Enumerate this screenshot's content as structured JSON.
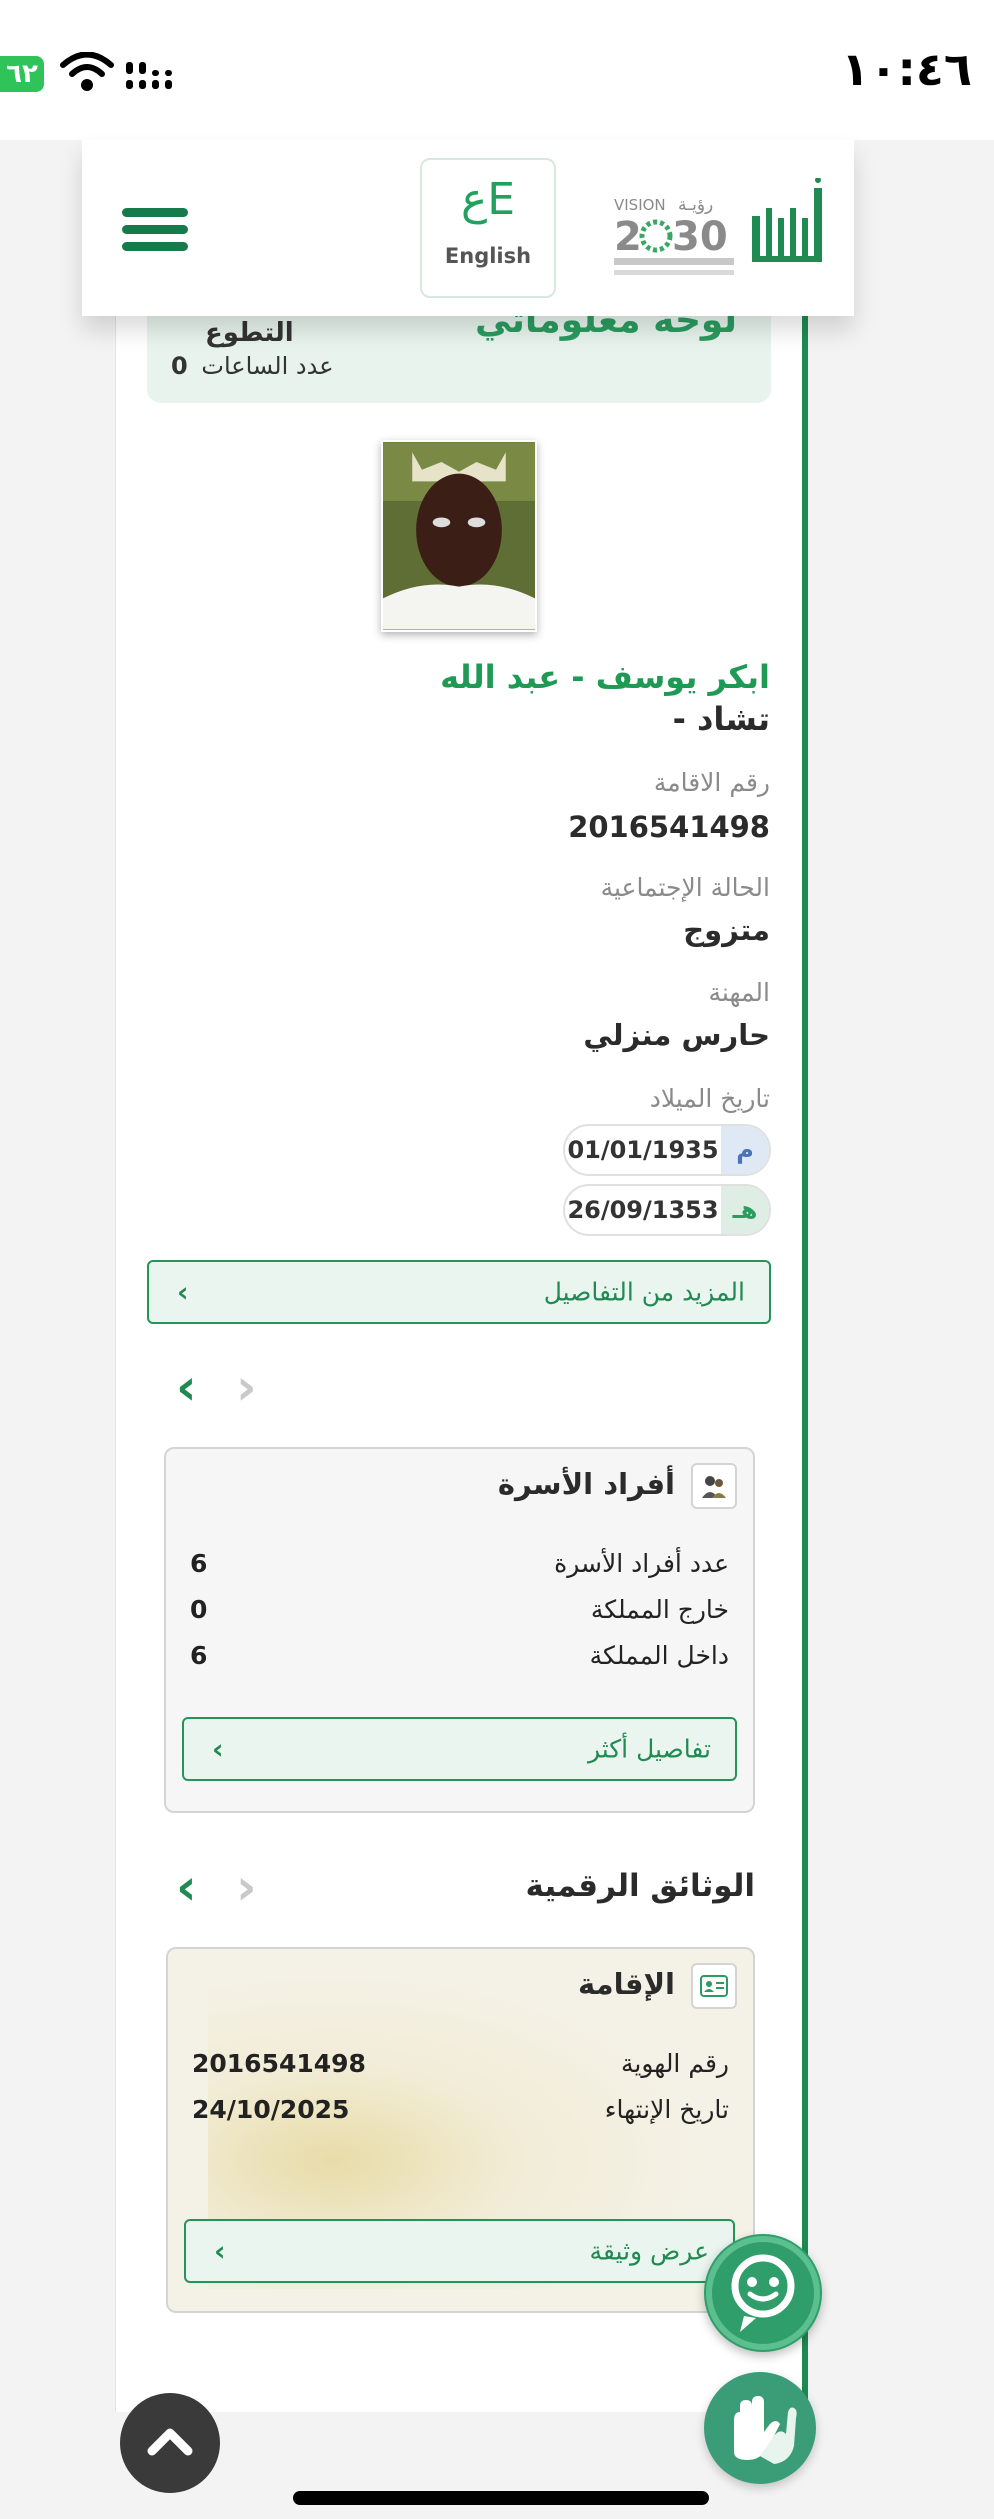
{
  "status_bar": {
    "time": "١٠:٤٦",
    "battery": "٦٢"
  },
  "header": {
    "language_button": "English",
    "language_glyph": "عE",
    "menu_icon": "hamburger-menu-icon"
  },
  "dashboard": {
    "title": "لوحة معلوماتي",
    "volunteer_label": "التطوع",
    "hours_value": "0",
    "hours_label": "عدد الساعات"
  },
  "profile": {
    "name": "ابكر يوسف - عبد الله",
    "nationality": "تشاد -",
    "iqama_label": "رقم الاقامة",
    "iqama_value": "2016541498",
    "marital_label": "الحالة الإجتماعية",
    "marital_value": "متزوج",
    "job_label": "المهنة",
    "job_value": "حارس منزلي",
    "dob_label": "تاريخ الميلاد",
    "dob_gregorian_badge": "م",
    "dob_gregorian": "01/01/1935",
    "dob_hijri_badge": "هـ",
    "dob_hijri": "26/09/1353",
    "more_details": "المزيد من التفاصيل"
  },
  "family_card": {
    "title": "أفراد الأسرة",
    "rows": [
      {
        "label": "عدد أفراد الأسرة",
        "value": "6"
      },
      {
        "label": "خارج المملكة",
        "value": "0"
      },
      {
        "label": "داخل المملكة",
        "value": "6"
      }
    ],
    "button": "تفاصيل أكثر"
  },
  "digital_docs": {
    "title": "الوثائق الرقمية",
    "card_title": "الإقامة",
    "rows": [
      {
        "label": "رقم الهوية",
        "value": "2016541498"
      },
      {
        "label": "تاريخ الإنتهاء",
        "value": "24/10/2025"
      }
    ],
    "button": "عرض وثيقة"
  },
  "nav": {
    "prev": "‹",
    "next": "›",
    "chevron": "›"
  },
  "colors": {
    "primary_green": "#1f8a52",
    "light_green_bg": "#ebf5ef",
    "page_bg": "#f3f3f3"
  }
}
